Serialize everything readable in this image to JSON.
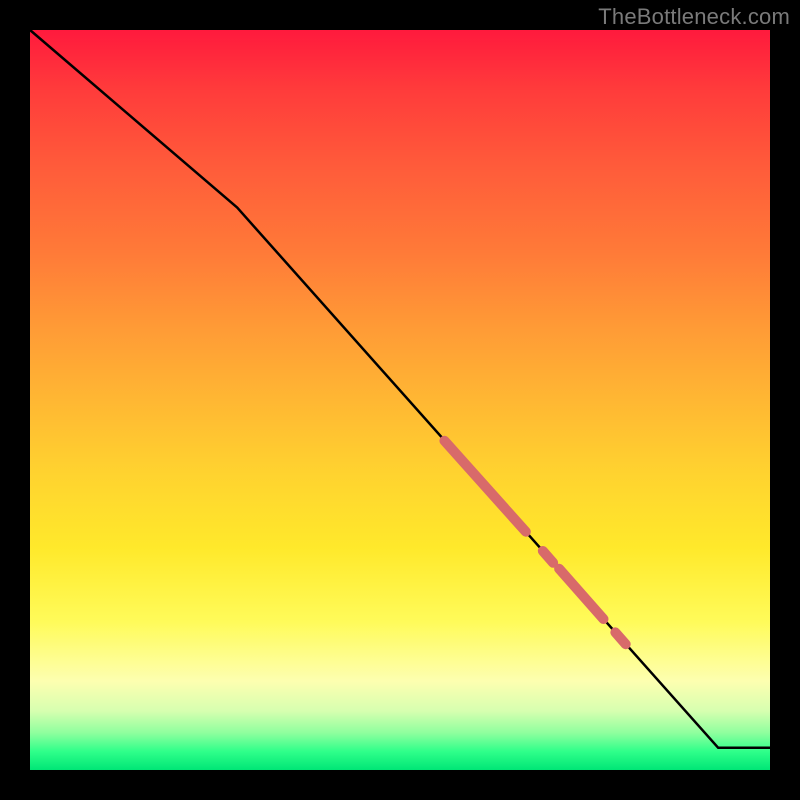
{
  "watermark": "TheBottleneck.com",
  "colors": {
    "background": "#000000",
    "line": "#000000",
    "accent_marker": "#d86a6a",
    "gradient_stops": [
      "#ff1a3d",
      "#ff7a38",
      "#ffd32f",
      "#fdffb0",
      "#00e676"
    ]
  },
  "chart_data": {
    "type": "line",
    "title": "",
    "xlabel": "",
    "ylabel": "",
    "xlim": [
      0,
      100
    ],
    "ylim": [
      0,
      100
    ],
    "grid": false,
    "legend": false,
    "line": {
      "x": [
        0,
        28,
        93,
        100
      ],
      "y": [
        100,
        76,
        3,
        3
      ]
    },
    "accent_segments": [
      {
        "x0": 56.0,
        "y0": 44.5,
        "x1": 67.0,
        "y1": 32.2,
        "width": 10
      },
      {
        "x0": 69.3,
        "y0": 29.6,
        "x1": 70.7,
        "y1": 28.0,
        "width": 10
      },
      {
        "x0": 71.5,
        "y0": 27.2,
        "x1": 77.5,
        "y1": 20.4,
        "width": 10
      },
      {
        "x0": 79.1,
        "y0": 18.6,
        "x1": 80.5,
        "y1": 17.0,
        "width": 10
      }
    ]
  }
}
